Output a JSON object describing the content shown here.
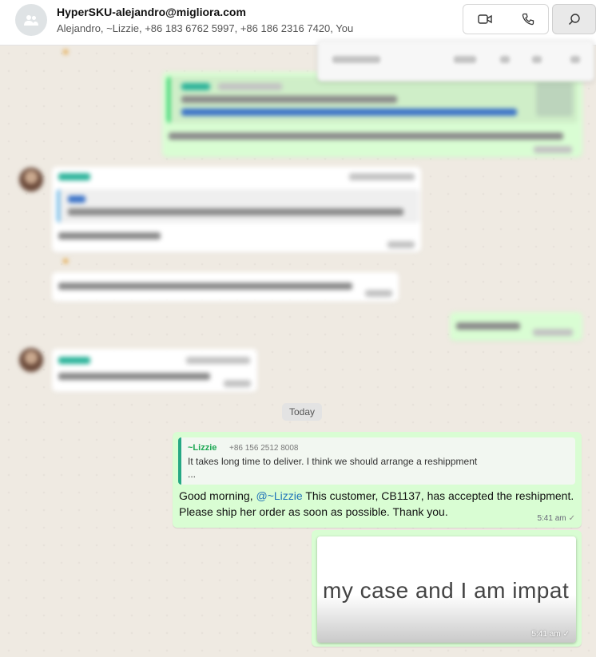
{
  "header": {
    "title": "HyperSKU-alejandro@migliora.com",
    "participants": "Alejandro, ~Lizzie, +86 183 6762 5997, +86 186 2316 7420, You",
    "icons": {
      "avatar": "group-icon",
      "video": "video-call-icon",
      "voice": "voice-call-icon",
      "search": "search-icon"
    }
  },
  "chat": {
    "date_separator": "Today",
    "messages": [
      {
        "reply": {
          "author": "~Lizzie",
          "phone": "+86 156 2512 8008",
          "text": "It takes long time to deliver. I think we should arrange a reshippment",
          "ellipsis": "..."
        },
        "text_before": "Good morning, ",
        "mention": "@~Lizzie",
        "text_after": " This customer, CB1137, has accepted the reshipment. Please ship her order as soon as possible. Thank you.",
        "time": "5:41 am",
        "status": "✓"
      },
      {
        "image_text": "my case and I am impat",
        "time": "5:41 am",
        "status": "✓"
      }
    ]
  },
  "colors": {
    "outgoing_bubble": "#d9fdd3",
    "incoming_bubble": "#ffffff",
    "chat_background": "#efeae2",
    "mention": "#1f72b8",
    "author": "#1fa855"
  }
}
